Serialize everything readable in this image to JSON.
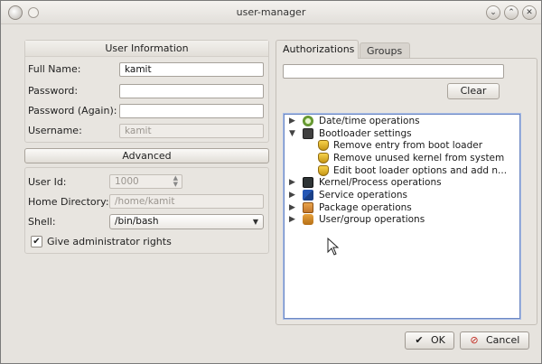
{
  "window": {
    "title": "user-manager"
  },
  "user_info": {
    "header": "User Information",
    "full_name_label": "Full Name:",
    "full_name_value": "kamit",
    "password_label": "Password:",
    "password_again_label": "Password (Again):",
    "username_label": "Username:",
    "username_value": "kamit"
  },
  "advanced": {
    "header": "Advanced",
    "user_id_label": "User Id:",
    "user_id_value": "1000",
    "home_dir_label": "Home Directory:",
    "home_dir_value": "/home/kamit",
    "shell_label": "Shell:",
    "shell_value": "/bin/bash",
    "admin_checkbox_label": "Give administrator rights",
    "admin_checked": true
  },
  "tabs": [
    {
      "label": "Authorizations",
      "active": true
    },
    {
      "label": "Groups",
      "active": false
    }
  ],
  "authorizations": {
    "filter_value": "",
    "clear_label": "Clear",
    "tree": [
      {
        "label": "Date/time operations",
        "level": 0,
        "expander": "▶",
        "icon": "clock-icon"
      },
      {
        "label": "Bootloader settings",
        "level": 0,
        "expander": "▼",
        "icon": "floppy-icon"
      },
      {
        "label": "Remove entry from boot loader",
        "level": 1,
        "expander": "",
        "icon": "shield-icon"
      },
      {
        "label": "Remove unused kernel from system",
        "level": 1,
        "expander": "",
        "icon": "shield-icon"
      },
      {
        "label": "Edit boot loader options and add n...",
        "level": 1,
        "expander": "",
        "icon": "shield-icon"
      },
      {
        "label": "Kernel/Process operations",
        "level": 0,
        "expander": "▶",
        "icon": "terminal-icon"
      },
      {
        "label": "Service operations",
        "level": 0,
        "expander": "▶",
        "icon": "flag-icon"
      },
      {
        "label": "Package operations",
        "level": 0,
        "expander": "▶",
        "icon": "package-icon"
      },
      {
        "label": "User/group operations",
        "level": 0,
        "expander": "▶",
        "icon": "users-icon"
      }
    ]
  },
  "buttons": {
    "ok_label": "OK",
    "cancel_label": "Cancel"
  }
}
